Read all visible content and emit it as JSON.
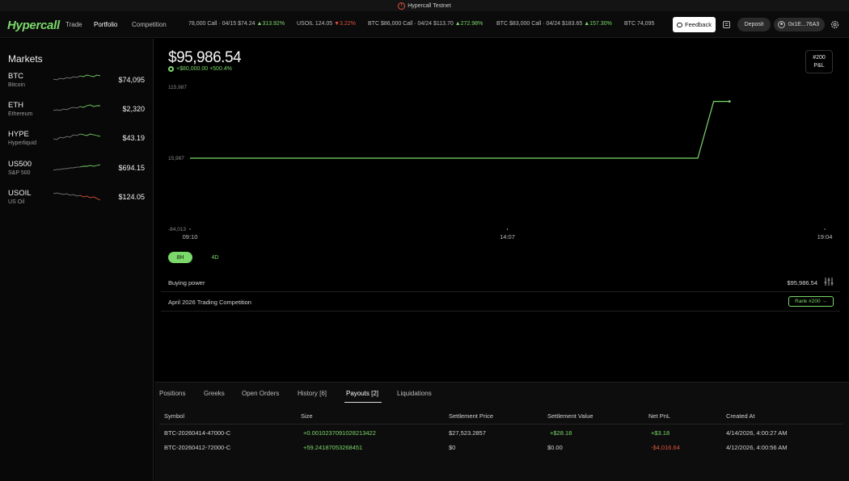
{
  "banner": {
    "text": "Hypercall Testnet"
  },
  "nav": {
    "logo": "Hypercall",
    "links": [
      "Trade",
      "Portfolio",
      "Competition"
    ],
    "active": "Portfolio",
    "feedback_label": "Feedback",
    "deposit_label": "Deposit",
    "wallet_label": "0x1E...76A3"
  },
  "tickers": [
    {
      "name": "78,000 Call · 04/15",
      "price": "$74.24",
      "change": "▲313.92%",
      "dir": "up"
    },
    {
      "name": "USOIL",
      "price": "124.05",
      "change": "▼3.22%",
      "dir": "down"
    },
    {
      "name": "BTC $86,000 Call · 04/24",
      "price": "$113.70",
      "change": "▲272.98%",
      "dir": "up"
    },
    {
      "name": "BTC $83,000 Call · 04/24",
      "price": "$183.65",
      "change": "▲157.30%",
      "dir": "up"
    },
    {
      "name": "BTC",
      "price": "74,095",
      "change": "",
      "dir": "none"
    }
  ],
  "sidebar": {
    "title": "Markets",
    "markets": [
      {
        "symbol": "BTC",
        "name": "Bitcoin",
        "price": "$74,095",
        "spark": [
          9,
          10,
          8,
          9,
          7,
          8,
          6,
          7,
          5,
          6,
          4,
          5,
          6,
          4,
          5
        ]
      },
      {
        "symbol": "ETH",
        "name": "Ethereum",
        "price": "$2,320",
        "spark": [
          12,
          11,
          12,
          10,
          11,
          9,
          8,
          9,
          7,
          8,
          6,
          5,
          7,
          6,
          6
        ]
      },
      {
        "symbol": "HYPE",
        "name": "Hyperliquid",
        "price": "$43.19",
        "spark": [
          11,
          12,
          9,
          10,
          8,
          9,
          6,
          7,
          5,
          6,
          7,
          5,
          6,
          7,
          8
        ]
      },
      {
        "symbol": "US500",
        "name": "S&P 500",
        "price": "$694.15",
        "spark": [
          13,
          12,
          12,
          11,
          11,
          10,
          10,
          9,
          9,
          8,
          8,
          7,
          8,
          7,
          6
        ]
      },
      {
        "symbol": "USOIL",
        "name": "US Oil",
        "price": "$124.05",
        "spark": [
          6,
          5,
          6,
          7,
          6,
          8,
          7,
          9,
          8,
          10,
          9,
          11,
          10,
          12,
          14
        ]
      }
    ]
  },
  "portfolio": {
    "value": "$95,986.54",
    "change": "+$80,000.00 +500.4%",
    "rank_number": "#200",
    "rank_label": "P&L",
    "ranges": [
      "8H",
      "4D"
    ],
    "buying_power_label": "Buying power",
    "buying_power_value": "$95,986.54",
    "competition_label": "April 2026 Trading Competition",
    "competition_rank": "Rank #200 →"
  },
  "chart_data": {
    "type": "line",
    "x": [
      "09:10",
      "14:07",
      "19:04"
    ],
    "x_ticks": [
      "09:10",
      "14:07",
      "19:04"
    ],
    "y_ticks": [
      "115,987",
      "15,987",
      "-84,013"
    ],
    "ylim": [
      -84013,
      115987
    ],
    "series": [
      {
        "points": [
          [
            0,
            15987
          ],
          [
            0.8,
            15987
          ],
          [
            0.825,
            95986.54
          ],
          [
            0.85,
            95986.54
          ]
        ]
      }
    ]
  },
  "tabs": [
    "Positions",
    "Greeks",
    "Open Orders",
    "History [6]",
    "Payouts [2]",
    "Liquidations"
  ],
  "active_tab": "Payouts [2]",
  "table": {
    "headers": [
      "Symbol",
      "Size",
      "Settlement Price",
      "Settlement Value",
      "Net PnL",
      "Created At"
    ],
    "rows": [
      [
        "BTC-20260414-47000-C",
        "+0.0010237091028213422",
        "$27,523.2857",
        "+$28.18",
        "+$3.18",
        "4/14/2026, 4:00:27 AM"
      ],
      [
        "BTC-20260412-72000-C",
        "+59.24187053268451",
        "$0",
        "$0.00",
        "-$4,016.64",
        "4/12/2026, 4:00:56 AM"
      ]
    ]
  },
  "colors": {
    "accent": "#7bd86a",
    "negative": "#e0533c",
    "background": "#000000"
  }
}
